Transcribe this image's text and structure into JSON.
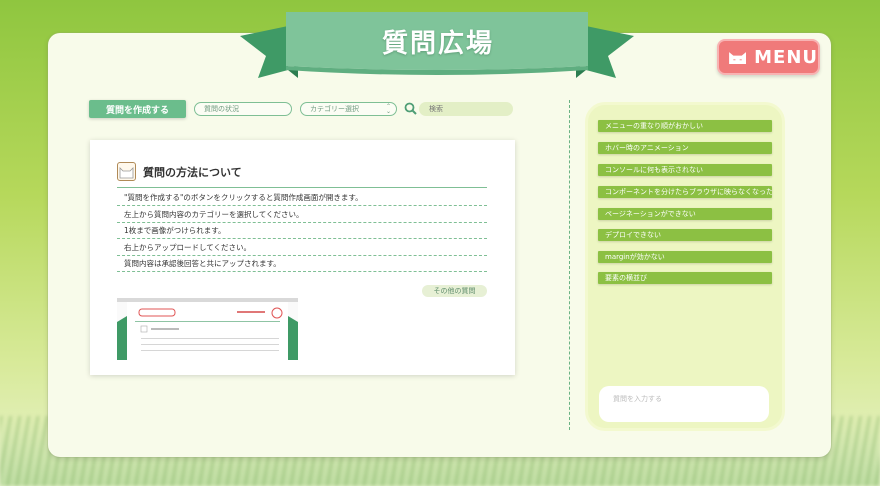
{
  "header": {
    "title": "質問広場"
  },
  "menu": {
    "label": "MENU",
    "icon": "cat-face-icon"
  },
  "toolbar": {
    "create_label": "質問を作成する",
    "status_label": "質問の状況",
    "category_label": "カテゴリー選択",
    "search_placeholder": "検索"
  },
  "card": {
    "title": "質問の方法について",
    "steps": [
      "\"質問を作成する\"のボタンをクリックすると質問作成画面が開きます。",
      "左上から質問内容のカテゴリーを選択してください。",
      "1枚まで画像がつけられます。",
      "右上からアップロードしてください。",
      "質問内容は承認後回答と共にアップされます。"
    ],
    "other_label": "その他の質問"
  },
  "topics": [
    "メニューの重なり順がおかしい",
    "ホバー時のアニメーション",
    "コンソールに何も表示されない",
    "コンポーネントを分けたらブラウザに映らなくなった",
    "ページネーションができない",
    "デプロイできない",
    "marginが効かない",
    "要素の横並び"
  ],
  "ask": {
    "placeholder": "質問を入力する"
  },
  "colors": {
    "accent_green": "#6bbd8c",
    "topic_green": "#8cc043",
    "menu_red": "#f07a7a"
  }
}
